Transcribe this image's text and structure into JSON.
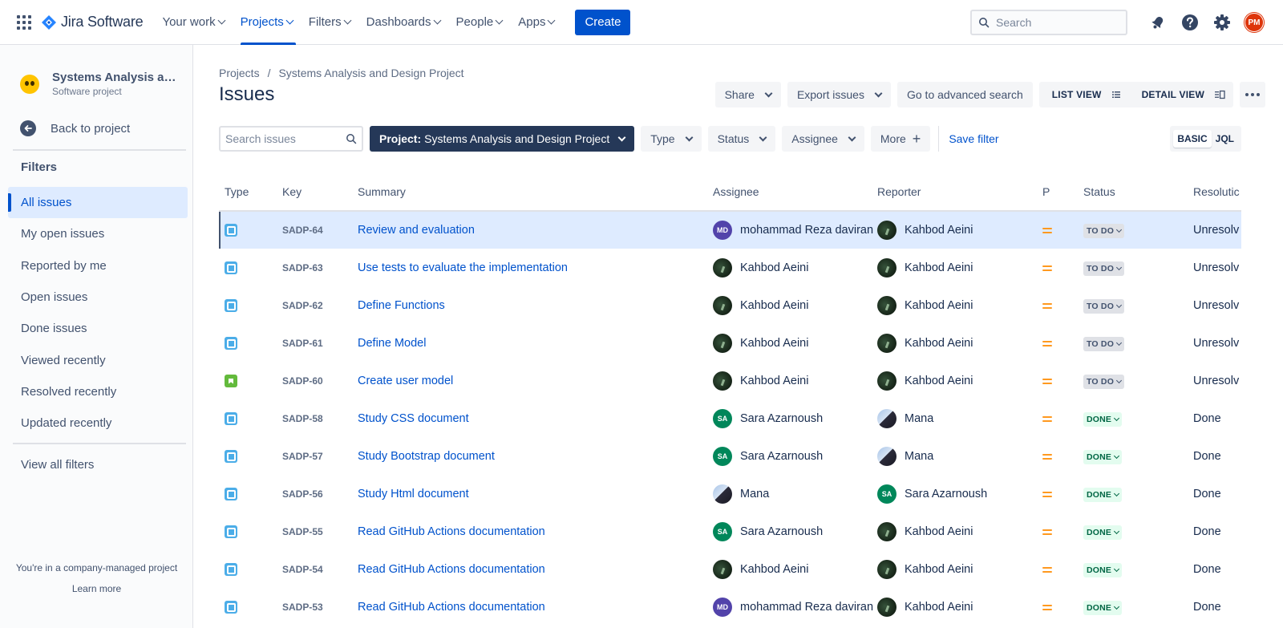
{
  "topnav": {
    "app_name": "Jira Software",
    "items": [
      {
        "label": "Your work"
      },
      {
        "label": "Projects"
      },
      {
        "label": "Filters"
      },
      {
        "label": "Dashboards"
      },
      {
        "label": "People"
      },
      {
        "label": "Apps"
      }
    ],
    "create_label": "Create",
    "search_placeholder": "Search",
    "user_initials": "PM",
    "brand_color": "#0052cc",
    "icons": [
      "app-switcher-icon",
      "jira-logo-icon",
      "notifications-icon",
      "help-icon",
      "settings-icon"
    ]
  },
  "sidebar": {
    "project_name": "Systems Analysis and...",
    "project_type": "Software project",
    "back_label": "Back to project",
    "filters_heading": "Filters",
    "items": [
      {
        "label": "All issues"
      },
      {
        "label": "My open issues"
      },
      {
        "label": "Reported by me"
      },
      {
        "label": "Open issues"
      },
      {
        "label": "Done issues"
      },
      {
        "label": "Viewed recently"
      },
      {
        "label": "Resolved recently"
      },
      {
        "label": "Updated recently"
      }
    ],
    "view_all": "View all filters",
    "company_note": "You're in a company-managed project",
    "learn_more": "Learn more"
  },
  "main": {
    "breadcrumb": [
      "Projects",
      "Systems Analysis and Design Project"
    ],
    "title": "Issues",
    "actions": {
      "share": "Share",
      "export": "Export issues",
      "advanced": "Go to advanced search",
      "list_view": "LIST VIEW",
      "detail_view": "DETAIL VIEW"
    },
    "filters": {
      "search_placeholder": "Search issues",
      "project_label": "Project:",
      "project_value": "Systems Analysis and Design Project",
      "type": "Type",
      "status": "Status",
      "assignee": "Assignee",
      "more": "More",
      "save_filter": "Save filter",
      "basic": "BASIC",
      "jql": "JQL"
    },
    "columns": [
      "Type",
      "Key",
      "Summary",
      "Assignee",
      "Reporter",
      "P",
      "Status",
      "Resolutic"
    ],
    "rows": [
      {
        "type": "task",
        "key": "SADP-64",
        "summary": "Review and evaluation",
        "assignee": "mohammad Reza daviran",
        "assignee_avatar": "MD",
        "reporter": "Kahbod Aeini",
        "reporter_avatar": "kahbod",
        "status": "TO DO",
        "resolution": "Unresolv"
      },
      {
        "type": "task",
        "key": "SADP-63",
        "summary": "Use tests to evaluate the implementation",
        "assignee": "Kahbod Aeini",
        "assignee_avatar": "kahbod",
        "reporter": "Kahbod Aeini",
        "reporter_avatar": "kahbod",
        "status": "TO DO",
        "resolution": "Unresolv"
      },
      {
        "type": "task",
        "key": "SADP-62",
        "summary": "Define Functions",
        "assignee": "Kahbod Aeini",
        "assignee_avatar": "kahbod",
        "reporter": "Kahbod Aeini",
        "reporter_avatar": "kahbod",
        "status": "TO DO",
        "resolution": "Unresolv"
      },
      {
        "type": "task",
        "key": "SADP-61",
        "summary": "Define Model",
        "assignee": "Kahbod Aeini",
        "assignee_avatar": "kahbod",
        "reporter": "Kahbod Aeini",
        "reporter_avatar": "kahbod",
        "status": "TO DO",
        "resolution": "Unresolv"
      },
      {
        "type": "story",
        "key": "SADP-60",
        "summary": "Create user model",
        "assignee": "Kahbod Aeini",
        "assignee_avatar": "kahbod",
        "reporter": "Kahbod Aeini",
        "reporter_avatar": "kahbod",
        "status": "TO DO",
        "resolution": "Unresolv"
      },
      {
        "type": "task",
        "key": "SADP-58",
        "summary": "Study CSS document",
        "assignee": "Sara Azarnoush",
        "assignee_avatar": "SA",
        "reporter": "Mana",
        "reporter_avatar": "mana",
        "status": "DONE",
        "resolution": "Done"
      },
      {
        "type": "task",
        "key": "SADP-57",
        "summary": "Study Bootstrap document",
        "assignee": "Sara Azarnoush",
        "assignee_avatar": "SA",
        "reporter": "Mana",
        "reporter_avatar": "mana",
        "status": "DONE",
        "resolution": "Done"
      },
      {
        "type": "task",
        "key": "SADP-56",
        "summary": "Study Html document",
        "assignee": "Mana",
        "assignee_avatar": "mana",
        "reporter": "Sara Azarnoush",
        "reporter_avatar": "SA",
        "status": "DONE",
        "resolution": "Done"
      },
      {
        "type": "task",
        "key": "SADP-55",
        "summary": "Read GitHub Actions documentation",
        "assignee": "Sara Azarnoush",
        "assignee_avatar": "SA",
        "reporter": "Kahbod Aeini",
        "reporter_avatar": "kahbod",
        "status": "DONE",
        "resolution": "Done"
      },
      {
        "type": "task",
        "key": "SADP-54",
        "summary": "Read GitHub Actions documentation",
        "assignee": "Kahbod Aeini",
        "assignee_avatar": "kahbod",
        "reporter": "Kahbod Aeini",
        "reporter_avatar": "kahbod",
        "status": "DONE",
        "resolution": "Done"
      },
      {
        "type": "task",
        "key": "SADP-53",
        "summary": "Read GitHub Actions documentation",
        "assignee": "mohammad Reza daviran",
        "assignee_avatar": "MD",
        "reporter": "Kahbod Aeini",
        "reporter_avatar": "kahbod",
        "status": "DONE",
        "resolution": "Done"
      }
    ],
    "priority_color": "#ff991f",
    "status_colors": {
      "todo": "#dfe1e6",
      "done": "#e3fcef"
    }
  }
}
